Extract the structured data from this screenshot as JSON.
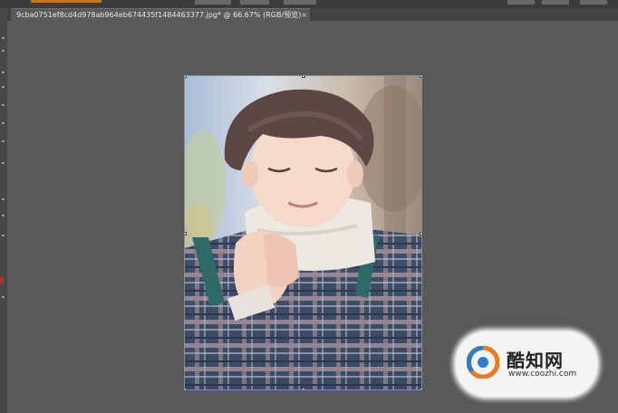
{
  "document": {
    "tab_title": "9cba0751ef8cd4d978ab964eb674435f1484463377.jpg* @ 66.67% (RGB/预览)",
    "close_glyph": "×"
  },
  "watermark": {
    "brand": "酷知网",
    "url": "www.coozhi.com"
  },
  "colors": {
    "workspace": "#595959",
    "tab_active": "#5a5a5a",
    "selection_border": "#7a86c8",
    "logo_orange": "#f07a1a",
    "logo_blue": "#2a7fd4"
  }
}
